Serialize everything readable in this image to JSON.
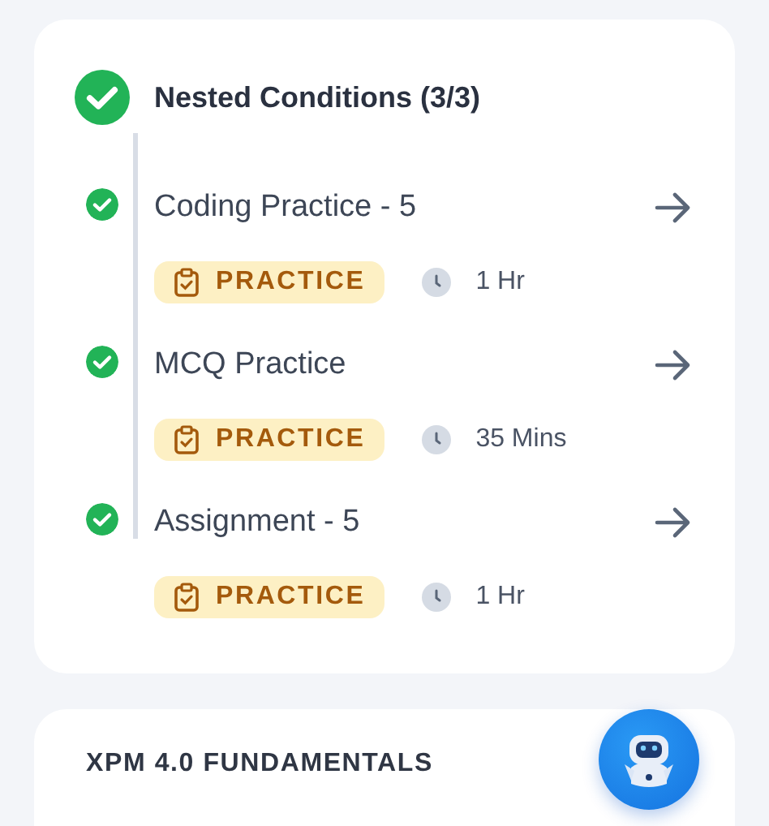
{
  "module": {
    "title": "Nested Conditions (3/3)",
    "completed": true,
    "items": [
      {
        "title": "Coding Practice - 5",
        "completed": true,
        "tag": "PRACTICE",
        "duration": "1 Hr"
      },
      {
        "title": "MCQ Practice",
        "completed": true,
        "tag": "PRACTICE",
        "duration": "35 Mins"
      },
      {
        "title": "Assignment - 5",
        "completed": true,
        "tag": "PRACTICE",
        "duration": "1 Hr"
      }
    ]
  },
  "next_section": {
    "title": "XPM 4.0 FUNDAMENTALS"
  }
}
